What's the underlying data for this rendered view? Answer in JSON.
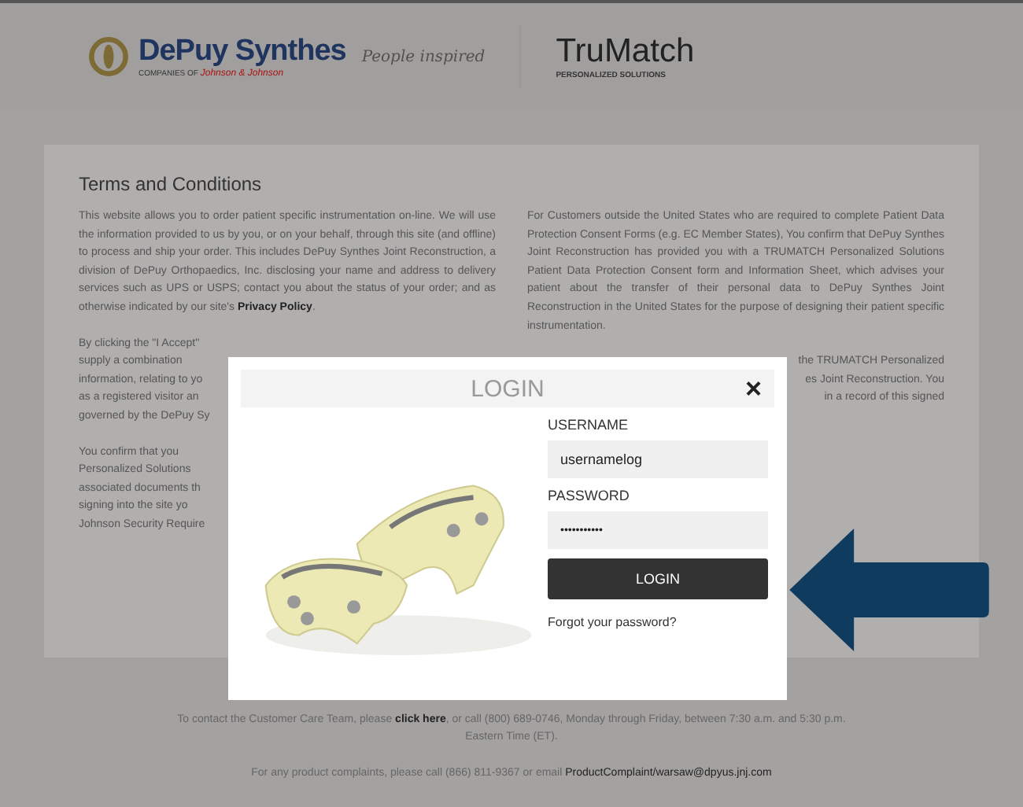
{
  "header": {
    "brand": "DePuy Synthes",
    "brand_sub": "COMPANIES OF",
    "brand_parent": "Johnson & Johnson",
    "tagline": "People inspired",
    "product": "TruMatch",
    "product_sub": "PERSONALIZED SOLUTIONS"
  },
  "terms": {
    "title": "Terms and Conditions",
    "left_intro": {
      "before": "This website allows you to order patient specific instrumentation on-line. We will use the information provided to us by you, or on your behalf, through this site (and offline) to process and ship your order. This includes DePuy Synthes Joint Reconstruction, a division of DePuy Orthopaedics, Inc. disclosing your name and address to delivery services such as UPS or USPS; contact you about the status of your order; and as otherwise indicated by our site's ",
      "link": "Privacy Policy",
      "after": "."
    },
    "left_partial": [
      [
        "By clicking the \"I Accept\"",
        "supply a combination",
        "information, relating to yo",
        "as a registered visitor an",
        "governed by the DePuy Sy"
      ],
      [
        "You confirm that you",
        "Personalized Solutions",
        "associated documents th",
        "signing into the site yo",
        "Johnson Security Require"
      ]
    ],
    "right_visible": "For Customers outside the United States who are required to complete Patient Data Protection Consent Forms (e.g. EC Member States), You confirm that DePuy Synthes Joint Reconstruction has provided you with a TRUMATCH Personalized Solutions Patient Data Protection Consent form and Information Sheet, which advises your patient about the transfer of their personal data to DePuy Synthes Joint Reconstruction in the United States for the purpose of designing their patient specific instrumentation.",
    "right_partial": [
      "the TRUMATCH Personalized",
      "es Joint Reconstruction. You",
      "in a record of this signed"
    ]
  },
  "login": {
    "title": "LOGIN",
    "close": "×",
    "username_label": "USERNAME",
    "username_value": "usernamelog",
    "password_label": "PASSWORD",
    "password_value": "•••••••••••",
    "button": "LOGIN",
    "forgot": "Forgot your password?"
  },
  "footer": {
    "contact_before": "To contact the Customer Care Team, please ",
    "contact_link": "click here",
    "contact_after": ", or call (800) 689-0746, Monday through Friday, between 7:30 a.m. and 5:30 p.m. Eastern Time (ET).",
    "complaints_before": "For any product complaints, please call (866) 811-9367 or email ",
    "complaints_link": "ProductComplaint/warsaw@dpyus.jnj.com"
  }
}
